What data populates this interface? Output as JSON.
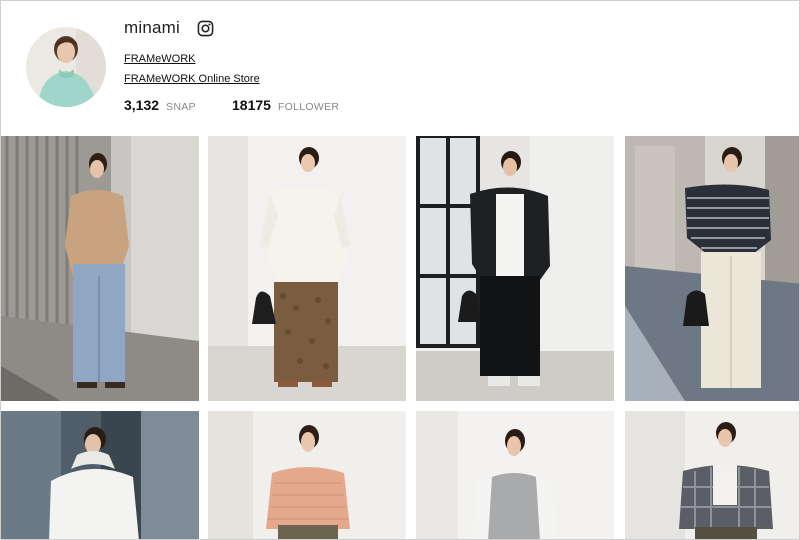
{
  "profile": {
    "username": "minami",
    "links": [
      "FRAMeWORK",
      "FRAMeWORK Online Store"
    ],
    "stats": {
      "snap_count": "3,132",
      "snap_label": "SNAP",
      "follower_count": "18175",
      "follower_label": "FOLLOWER"
    },
    "icons": {
      "social": "instagram-icon"
    }
  },
  "grid": {
    "rows": 2,
    "columns": 4,
    "items": [
      {
        "top": "beige-knit-henley",
        "bottom": "light-denim-jeans",
        "background": "outdoor-concrete"
      },
      {
        "top": "white-knit-sweater",
        "bottom": "brown-lace-pants",
        "bag": "black-handbag",
        "background": "white-studio"
      },
      {
        "top": "black-hooded-jacket",
        "bottom": "black-pants",
        "bag": "black-handbag",
        "background": "window-studio"
      },
      {
        "top": "navy-striped-tee",
        "bottom": "ivory-satin-cargo-pants",
        "bag": "black-handbag",
        "background": "outdoor-sunlit"
      },
      {
        "top": "white-hooded-jacket",
        "background": "outdoor-glass"
      },
      {
        "top": "peach-knit-sweater",
        "bottom": "olive-pants",
        "background": "beige-studio"
      },
      {
        "top": "grey-vest-layered",
        "background": "white-studio"
      },
      {
        "top": "plaid-flannel-shirt",
        "bottom": "olive-skirt",
        "background": "white-studio"
      }
    ]
  },
  "colors": {
    "text": "#222222",
    "muted": "#888888",
    "avatar_sweater": "#9fd6c9"
  }
}
